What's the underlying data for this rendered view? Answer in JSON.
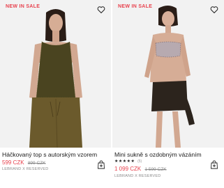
{
  "products": [
    {
      "badge": "NEW IN SALE",
      "title": "Háčkovaný top s autorským vzorem",
      "price_new": "599 CZK",
      "price_old": "899 CZK",
      "brand": "LEBRAND X RESERVED",
      "icons": {
        "wishlist": "heart-icon",
        "cart": "shopping-bag-plus-icon"
      }
    },
    {
      "badge": "NEW IN SALE",
      "title": "Mini sukně s ozdobným vázáním",
      "rating_stars": "★★★★★",
      "rating_count": "(5)",
      "price_new": "1 099 CZK",
      "price_old": "1 599 CZK",
      "brand": "LEBRAND X RESERVED",
      "icons": {
        "wishlist": "heart-icon",
        "cart": "shopping-bag-plus-icon"
      }
    }
  ],
  "colors": {
    "sale_red": "#e8414d",
    "text": "#1a1a1a",
    "muted": "#8b8b8b",
    "photo_bg": "#f1f1f1"
  }
}
